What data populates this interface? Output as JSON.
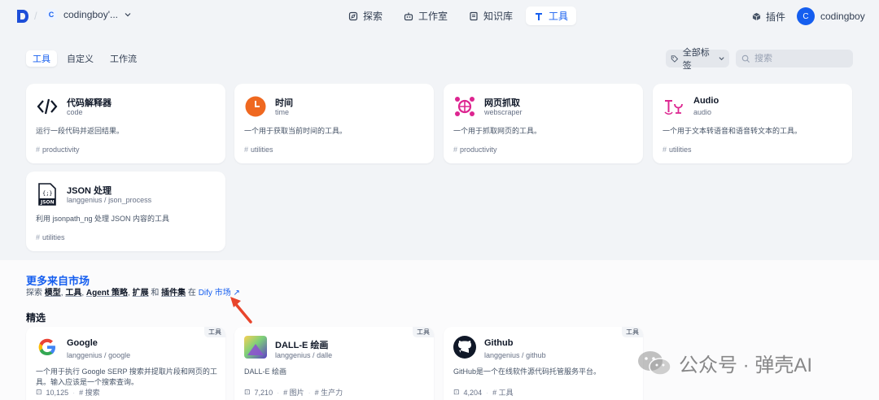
{
  "header": {
    "workspace_initial": "C",
    "workspace_name": "codingboy'...",
    "nav": [
      {
        "label": "探索",
        "icon": "explore-icon",
        "active": false
      },
      {
        "label": "工作室",
        "icon": "studio-icon",
        "active": false
      },
      {
        "label": "知识库",
        "icon": "knowledge-icon",
        "active": false
      },
      {
        "label": "工具",
        "icon": "tools-icon",
        "active": true
      }
    ],
    "plugins_label": "插件",
    "user_initial": "C",
    "user_name": "codingboy"
  },
  "tabs": [
    {
      "label": "工具",
      "active": true
    },
    {
      "label": "自定义",
      "active": false
    },
    {
      "label": "工作流",
      "active": false
    }
  ],
  "filters": {
    "tags_label": "全部标签",
    "search_placeholder": "搜索"
  },
  "tools": [
    {
      "name": "代码解释器",
      "id": "code",
      "description": "运行一段代码并返回结果。",
      "tag": "productivity",
      "icon": "code-icon"
    },
    {
      "name": "时间",
      "id": "time",
      "description": "一个用于获取当前时间的工具。",
      "tag": "utilities",
      "icon": "clock-icon"
    },
    {
      "name": "网页抓取",
      "id": "webscraper",
      "description": "一个用于抓取网页的工具。",
      "tag": "productivity",
      "icon": "webscraper-icon"
    },
    {
      "name": "Audio",
      "id": "audio",
      "description": "一个用于文本转语音和语音转文本的工具。",
      "tag": "utilities",
      "icon": "audio-icon"
    },
    {
      "name": "JSON 处理",
      "author": "langgenius",
      "id": "json_process",
      "description": "利用 jsonpath_ng 处理 JSON 内容的工具",
      "tag": "utilities",
      "icon": "json-icon"
    }
  ],
  "marketplace": {
    "title": "更多来自市场",
    "sub_prefix": "探索",
    "sub_items": [
      "模型",
      "工具",
      "Agent 策略",
      "扩展",
      "插件集"
    ],
    "sub_comma": ",",
    "sub_and": "和",
    "sub_in": "在",
    "link_label": "Dify 市场",
    "featured_label": "精选",
    "featured": [
      {
        "name": "Google",
        "author": "langgenius",
        "id": "google",
        "badge": "工具",
        "description": "一个用于执行 Google SERP 搜索并提取片段和网页的工具。输入应该是一个搜索查询。",
        "installs": "10,125",
        "tags": [
          "搜索"
        ],
        "icon": "google-icon"
      },
      {
        "name": "DALL-E 绘画",
        "author": "langgenius",
        "id": "dalle",
        "badge": "工具",
        "description": "DALL-E 绘画",
        "installs": "7,210",
        "tags": [
          "图片",
          "生产力"
        ],
        "icon": "dalle-icon"
      },
      {
        "name": "Github",
        "author": "langgenius",
        "id": "github",
        "badge": "工具",
        "description": "GitHub是一个在线软件源代码托管服务平台。",
        "installs": "4,204",
        "tags": [
          "工具"
        ],
        "icon": "github-icon"
      }
    ]
  },
  "watermark": {
    "text": "公众号 · 弹壳AI"
  },
  "colors": {
    "accent": "#155eef",
    "clock": "#ef6820",
    "webscraper": "#dd2590",
    "annotation_arrow": "#e8452c"
  }
}
